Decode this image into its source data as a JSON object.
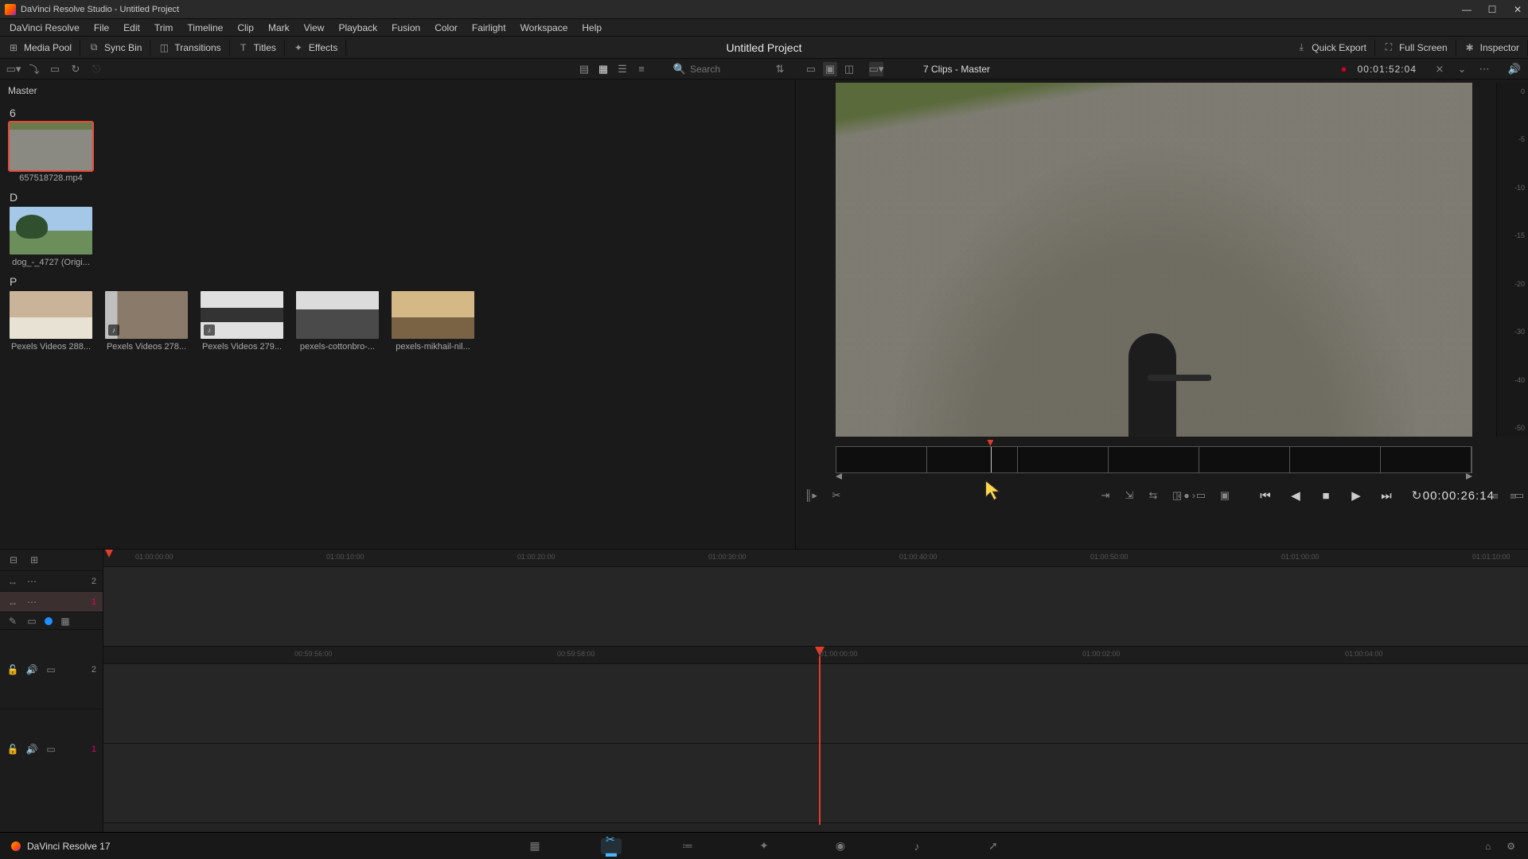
{
  "window": {
    "title": "DaVinci Resolve Studio - Untitled Project"
  },
  "menu": [
    "DaVinci Resolve",
    "File",
    "Edit",
    "Trim",
    "Timeline",
    "Clip",
    "Mark",
    "View",
    "Playback",
    "Fusion",
    "Color",
    "Fairlight",
    "Workspace",
    "Help"
  ],
  "top_panels": {
    "left": [
      {
        "label": "Media Pool",
        "icon": "⊞"
      },
      {
        "label": "Sync Bin",
        "icon": "⧉"
      },
      {
        "label": "Transitions",
        "icon": "◫"
      },
      {
        "label": "Titles",
        "icon": "T"
      },
      {
        "label": "Effects",
        "icon": "✦"
      }
    ],
    "center_title": "Untitled Project",
    "right": [
      {
        "label": "Quick Export",
        "icon": "⤓"
      },
      {
        "label": "Full Screen",
        "icon": "⛶"
      },
      {
        "label": "Inspector",
        "icon": "✱"
      }
    ]
  },
  "toolrow": {
    "search_placeholder": "Search",
    "clips_master": "7 Clips - Master",
    "timecode_header": "00:01:52:04"
  },
  "media": {
    "bin_name": "Master",
    "groups": [
      {
        "letter": "6",
        "items": [
          {
            "label": "657518728.mp4",
            "kind": "road",
            "selected": true
          }
        ]
      },
      {
        "letter": "D",
        "items": [
          {
            "label": "dog_-_4727 (Origi...",
            "kind": "dog"
          }
        ]
      },
      {
        "letter": "P",
        "items": [
          {
            "label": "Pexels Videos 288...",
            "kind": "p1"
          },
          {
            "label": "Pexels Videos 278...",
            "kind": "p2",
            "badge": "♪"
          },
          {
            "label": "Pexels Videos 279...",
            "kind": "p3",
            "badge": "♪"
          },
          {
            "label": "pexels-cottonbro-...",
            "kind": "p4"
          },
          {
            "label": "pexels-mikhail-nil...",
            "kind": "p5"
          }
        ]
      }
    ]
  },
  "transport": {
    "timecode": "00:00:26:14"
  },
  "meter_labels": [
    "0",
    "-5",
    "-10",
    "-15",
    "-20",
    "-30",
    "-40",
    "-50"
  ],
  "timeline": {
    "upper_ticks": [
      "01:00:00:00",
      "01:00:10:00",
      "01:00:20:00",
      "01:00:30:00",
      "01:00:40:00",
      "01:00:50:00",
      "01:01:00:00",
      "01:01:10:00"
    ],
    "lower_ticks": [
      "00:59:56:00",
      "00:59:58:00",
      "01:00:00:00",
      "01:00:02:00",
      "01:00:04:00"
    ],
    "video_tracks": [
      "2",
      "1"
    ],
    "audio_tracks": [
      "2",
      "1"
    ]
  },
  "footer": {
    "app_name": "DaVinci Resolve 17"
  }
}
